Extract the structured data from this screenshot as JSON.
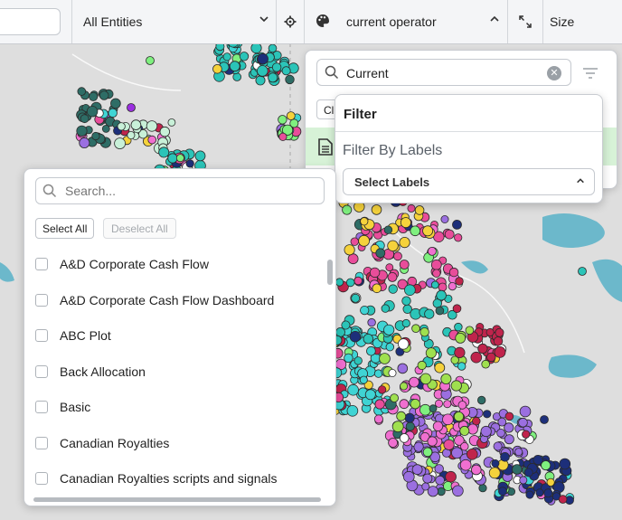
{
  "toolbar": {
    "entities_label": "All Entities",
    "color_by_label": "current operator",
    "size_label": "Size"
  },
  "operator_panel": {
    "search_value": "Current",
    "clear_button_label": "Cl"
  },
  "filter_popover": {
    "title": "Filter",
    "subtitle": "Filter By Labels",
    "select_label": "Select Labels"
  },
  "list_panel": {
    "search_placeholder": "Search...",
    "select_all": "Select All",
    "deselect_all": "Deselect All",
    "items": [
      "A&D Corporate Cash Flow",
      "A&D Corporate Cash Flow Dashboard",
      "ABC Plot",
      "Back Allocation",
      "Basic",
      "Canadian Royalties",
      "Canadian Royalties scripts and signals"
    ]
  },
  "colors": {
    "accent_row": "#d7f2d7",
    "map_background": "#dcdcdc",
    "water": "#5fb3c9"
  }
}
